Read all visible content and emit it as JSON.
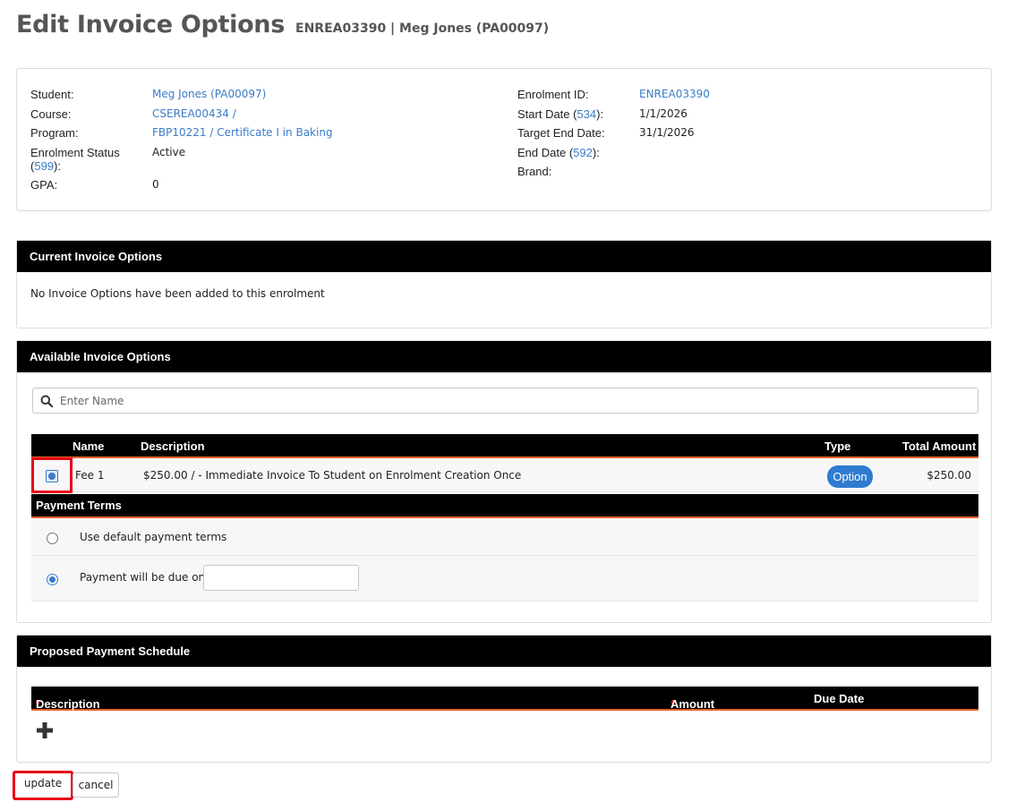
{
  "header": {
    "title": "Edit Invoice Options",
    "subtitle": "ENREA03390 | Meg Jones (PA00097)"
  },
  "info": {
    "left": [
      {
        "label": "Student:",
        "value": "Meg Jones (PA00097)",
        "link": true
      },
      {
        "label": "Course:",
        "value": "CSEREA00434 /",
        "link": true
      },
      {
        "label": "Program:",
        "value": "FBP10221 / Certificate I in Baking",
        "link": true
      },
      {
        "label_a": "Enrolment Status",
        "label_b": "(",
        "label_link": "599",
        "label_c": "):",
        "value": "Active"
      },
      {
        "label": "GPA:",
        "value": "0"
      }
    ],
    "right": [
      {
        "label": "Enrolment ID:",
        "value": "ENREA03390",
        "link": true
      },
      {
        "label_a": "Start Date (",
        "label_link": "534",
        "label_c": "):",
        "value": "1/1/2026"
      },
      {
        "label": "Target End Date:",
        "value": "31/1/2026"
      },
      {
        "label_a": "End Date (",
        "label_link": "592",
        "label_c": "):",
        "value": ""
      },
      {
        "label": "Brand:",
        "value": ""
      }
    ]
  },
  "current_options": {
    "title": "Current Invoice Options",
    "message": "No Invoice Options have been added to this enrolment"
  },
  "available_options": {
    "title": "Available Invoice Options",
    "search_placeholder": "Enter Name",
    "columns": {
      "name": "Name",
      "description": "Description",
      "type": "Type",
      "total": "Total Amount"
    },
    "rows": [
      {
        "name": "Fee 1",
        "description": "$250.00 / - Immediate Invoice To Student on Enrolment Creation Once",
        "type": "Option",
        "total": "$250.00",
        "selected": true
      }
    ],
    "payment_terms": {
      "title": "Payment Terms",
      "default_label": "Use default payment terms",
      "due_label": "Payment will be due on",
      "due_value": "",
      "selected": "due"
    }
  },
  "schedule": {
    "title": "Proposed Payment Schedule",
    "columns": {
      "description": "Description",
      "amount": "Amount",
      "due_date": "Due Date"
    },
    "required_mark": "*"
  },
  "actions": {
    "update": "update",
    "cancel": "cancel"
  },
  "colors": {
    "accent_blue": "#3a7bc8",
    "header_black": "#000000",
    "divider_orange": "#e8622a",
    "highlight_red": "#e8001a"
  }
}
